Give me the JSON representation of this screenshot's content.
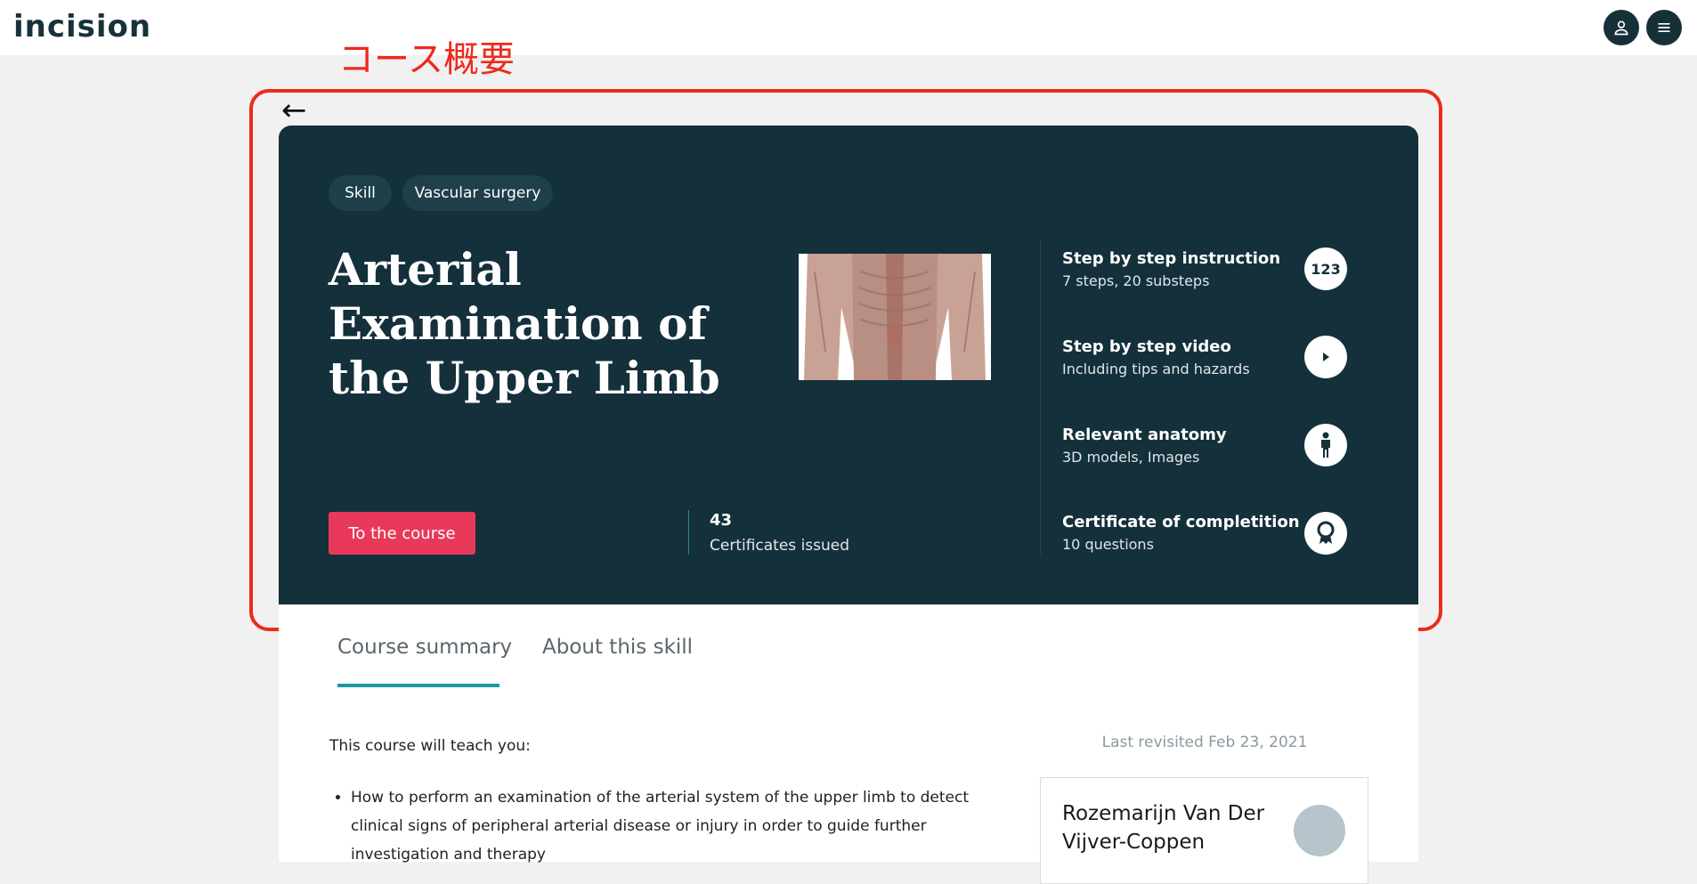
{
  "app": {
    "logo_text": "incision"
  },
  "header": {
    "user_icon": "user-icon",
    "menu_icon": "menu-icon"
  },
  "annotation": {
    "label": "コース概要",
    "color": "#ee2a1b"
  },
  "hero": {
    "back_icon": "arrow-left-icon",
    "tags": [
      "Skill",
      "Vascular surgery"
    ],
    "title": "Arterial Examination of the Upper Limb",
    "cta_label": "To the course",
    "certificates": {
      "count": "43",
      "label": "Certificates issued"
    },
    "features": [
      {
        "title": "Step by step instruction",
        "subtitle": "7 steps, 20 substeps",
        "icon": "numbers-123-icon",
        "icon_text": "123"
      },
      {
        "title": "Step by step video",
        "subtitle": "Including tips and hazards",
        "icon": "play-icon"
      },
      {
        "title": "Relevant anatomy",
        "subtitle": "3D models, Images",
        "icon": "person-icon"
      },
      {
        "title": "Certificate of completition",
        "subtitle": "10 questions",
        "icon": "award-icon"
      }
    ]
  },
  "tabs": [
    {
      "label": "Course summary",
      "active": true
    },
    {
      "label": "About this skill",
      "active": false
    }
  ],
  "summary": {
    "intro": "This course will teach you:",
    "bullets": [
      "How to perform an examination of the arterial system of the upper limb to detect clinical signs of peripheral arterial disease or injury in order to guide further investigation and therapy"
    ]
  },
  "sidebar": {
    "last_revisited": "Last revisited Feb 23, 2021",
    "author_name": "Rozemarijn Van Der Vijver-Coppen"
  },
  "colors": {
    "hero_bg": "#14303b",
    "cta": "#e8395a",
    "tab_accent": "#1b98a2"
  }
}
